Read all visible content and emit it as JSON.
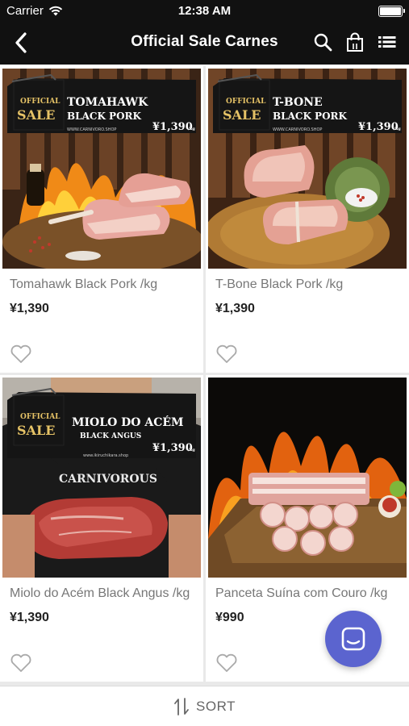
{
  "status_bar": {
    "carrier": "Carrier",
    "time": "12:38 AM"
  },
  "nav": {
    "title": "Official Sale Carnes",
    "back_icon": "chevron-left-icon",
    "icons": [
      "search-icon",
      "shopping-bag-icon",
      "list-icon"
    ]
  },
  "products": [
    {
      "name": "Tomahawk Black Pork /kg",
      "price": "¥1,390",
      "banner": {
        "badge": [
          "OFFICIAL",
          "SALE"
        ],
        "title": [
          "TOMAHAWK",
          "BLACK PORK"
        ],
        "price": "¥1,390",
        "unit": "/kg",
        "site": "WWW.CARNIVORO.SHOP"
      }
    },
    {
      "name": "T-Bone Black Pork /kg",
      "price": "¥1,390",
      "banner": {
        "badge": [
          "OFFICIAL",
          "SALE"
        ],
        "title": [
          "T-BONE",
          "BLACK PORK"
        ],
        "price": "¥1,390",
        "unit": "/kg",
        "site": "WWW.CARNIVORO.SHOP"
      }
    },
    {
      "name": "Miolo do Acém Black Angus /kg",
      "price": "¥1,390",
      "banner": {
        "badge": [
          "OFFICIAL",
          "SALE"
        ],
        "title": [
          "MIOLO DO ACÉM",
          "BLACK ANGUS"
        ],
        "price": "¥1,390",
        "unit": "/kg",
        "site": "www.ikiruchikara.shop"
      },
      "shirt_text": "CARNIVOROUS"
    },
    {
      "name": "Panceta Suína com Couro /kg",
      "price": "¥990"
    }
  ],
  "sort_label": "SORT",
  "colors": {
    "topbar": "#111111",
    "chat_button": "#5b64cf",
    "grid_bg": "#e9e9e9"
  }
}
